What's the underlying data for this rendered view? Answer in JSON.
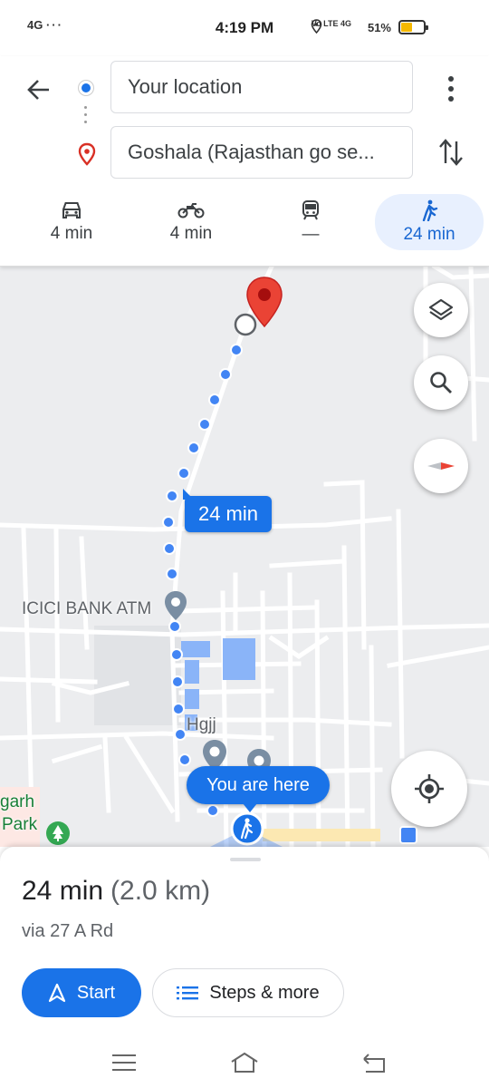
{
  "status_bar": {
    "network": "4G",
    "time": "4:19 PM",
    "indicators": "Vo LTE 4G",
    "battery_text": "51%",
    "battery_level": 0.51
  },
  "directions": {
    "origin": "Your location",
    "destination": "Goshala (Rajasthan go se..."
  },
  "travel_modes": [
    {
      "name": "car-icon",
      "time": "4 min"
    },
    {
      "name": "motorcycle-icon",
      "time": "4 min"
    },
    {
      "name": "transit-icon",
      "time": "—"
    },
    {
      "name": "walking-icon",
      "time": "24 min",
      "selected": true
    }
  ],
  "map": {
    "eta_bubble": "24 min",
    "you_are_here": "You are here",
    "labels": {
      "atm": "ICICI BANK ATM",
      "hgjj": "Hgjj",
      "park_line1": "garh",
      "park_line2": "Park"
    }
  },
  "route_summary": {
    "duration": "24 min",
    "distance": "(2.0 km)",
    "via": "via 27 A Rd",
    "start_label": "Start",
    "steps_label": "Steps & more"
  },
  "colors": {
    "accent": "#1a73e8",
    "destination_pin": "#ea4335",
    "map_bg": "#ecedef"
  }
}
